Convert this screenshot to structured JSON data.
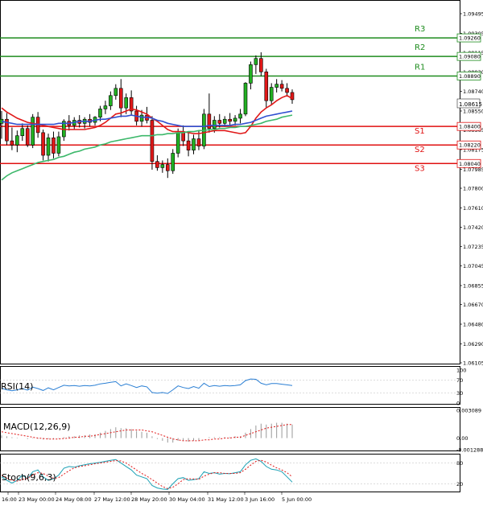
{
  "chart_data": {
    "type": "candlestick",
    "instrument_panel": {
      "price_ticks": [
        "1.09495",
        "1.09305",
        "1.09115",
        "1.08930",
        "1.08740",
        "1.08550",
        "1.08365",
        "1.08175",
        "1.07985",
        "1.07800",
        "1.07610",
        "1.07420",
        "1.07235",
        "1.07045",
        "1.06855",
        "1.06670",
        "1.06480",
        "1.06290",
        "1.06105"
      ],
      "ylim": [
        1.06105,
        1.09495
      ],
      "last_price": "1.08615",
      "levels": [
        {
          "name": "R3",
          "label": "1.09260",
          "value": 1.0926,
          "color": "#1e8c1e"
        },
        {
          "name": "R2",
          "label": "1.09080",
          "value": 1.0908,
          "color": "#1e8c1e"
        },
        {
          "name": "R1",
          "label": "1.08890",
          "value": 1.0889,
          "color": "#1e8c1e"
        },
        {
          "name": "S1",
          "label": "1.08400",
          "value": 1.084,
          "color": "#e01010"
        },
        {
          "name": "S2",
          "label": "1.08220",
          "value": 1.0822,
          "color": "#e01010"
        },
        {
          "name": "S3",
          "label": "1.08040",
          "value": 1.0804,
          "color": "#e01010"
        }
      ]
    },
    "x_ticks": [
      "16:00",
      "23 May 00:00",
      "24 May 08:00",
      "27 May 12:00",
      "28 May 20:00",
      "30 May 04:00",
      "31 May 12:00",
      "3 Jun 16:00",
      "5 Jun 00:00"
    ],
    "candles": [
      [
        1.0843,
        1.0855,
        1.0828,
        1.0847
      ],
      [
        1.0847,
        1.0853,
        1.0822,
        1.0826
      ],
      [
        1.0826,
        1.0839,
        1.0817,
        1.0822
      ],
      [
        1.0822,
        1.0836,
        1.0815,
        1.0831
      ],
      [
        1.0831,
        1.0843,
        1.0826,
        1.0838
      ],
      [
        1.0838,
        1.0841,
        1.082,
        1.0822
      ],
      [
        1.0822,
        1.0852,
        1.0819,
        1.0849
      ],
      [
        1.0849,
        1.0854,
        1.0829,
        1.0834
      ],
      [
        1.0834,
        1.0837,
        1.0807,
        1.0812
      ],
      [
        1.0812,
        1.0833,
        1.0806,
        1.0829
      ],
      [
        1.0829,
        1.0835,
        1.0809,
        1.0814
      ],
      [
        1.0814,
        1.0835,
        1.0811,
        1.083
      ],
      [
        1.083,
        1.0847,
        1.0826,
        1.0845
      ],
      [
        1.0845,
        1.0851,
        1.0836,
        1.0841
      ],
      [
        1.0841,
        1.0849,
        1.0837,
        1.0846
      ],
      [
        1.0846,
        1.0851,
        1.0839,
        1.0843
      ],
      [
        1.0843,
        1.0849,
        1.0838,
        1.0847
      ],
      [
        1.0847,
        1.0852,
        1.084,
        1.0844
      ],
      [
        1.0844,
        1.085,
        1.0841,
        1.0849
      ],
      [
        1.0849,
        1.086,
        1.0845,
        1.0857
      ],
      [
        1.0857,
        1.0865,
        1.0852,
        1.086
      ],
      [
        1.086,
        1.0874,
        1.0856,
        1.087
      ],
      [
        1.087,
        1.0881,
        1.0866,
        1.0877
      ],
      [
        1.0877,
        1.0886,
        1.0849,
        1.0858
      ],
      [
        1.0858,
        1.0872,
        1.0852,
        1.0868
      ],
      [
        1.0868,
        1.0875,
        1.0851,
        1.0855
      ],
      [
        1.0855,
        1.086,
        1.0841,
        1.0845
      ],
      [
        1.0845,
        1.0856,
        1.084,
        1.0851
      ],
      [
        1.0851,
        1.0859,
        1.0843,
        1.0846
      ],
      [
        1.0846,
        1.085,
        1.0798,
        1.0806
      ],
      [
        1.0806,
        1.0812,
        1.0797,
        1.08
      ],
      [
        1.08,
        1.0807,
        1.0795,
        1.0803
      ],
      [
        1.0803,
        1.0809,
        1.079,
        1.0797
      ],
      [
        1.0797,
        1.0818,
        1.0794,
        1.0814
      ],
      [
        1.0814,
        1.0838,
        1.081,
        1.0834
      ],
      [
        1.0834,
        1.0841,
        1.0821,
        1.0826
      ],
      [
        1.0826,
        1.0835,
        1.0811,
        1.0817
      ],
      [
        1.0817,
        1.0832,
        1.0813,
        1.0828
      ],
      [
        1.0828,
        1.0836,
        1.0817,
        1.0821
      ],
      [
        1.0821,
        1.0857,
        1.0818,
        1.0852
      ],
      [
        1.0852,
        1.0872,
        1.0834,
        1.0838
      ],
      [
        1.0838,
        1.085,
        1.0834,
        1.0846
      ],
      [
        1.0846,
        1.0852,
        1.0839,
        1.0843
      ],
      [
        1.0843,
        1.085,
        1.084,
        1.0847
      ],
      [
        1.0847,
        1.0853,
        1.0841,
        1.0845
      ],
      [
        1.0845,
        1.0851,
        1.0841,
        1.0848
      ],
      [
        1.0848,
        1.0857,
        1.0843,
        1.0852
      ],
      [
        1.0852,
        1.0883,
        1.085,
        1.0882
      ],
      [
        1.0882,
        1.0903,
        1.0876,
        1.09
      ],
      [
        1.09,
        1.0909,
        1.0891,
        1.0906
      ],
      [
        1.0906,
        1.0912,
        1.0889,
        1.0893
      ],
      [
        1.0893,
        1.0896,
        1.0858,
        1.0865
      ],
      [
        1.0865,
        1.0882,
        1.0861,
        1.0878
      ],
      [
        1.0878,
        1.0886,
        1.0873,
        1.0881
      ],
      [
        1.0881,
        1.0885,
        1.0874,
        1.0877
      ],
      [
        1.0877,
        1.0882,
        1.0869,
        1.0873
      ],
      [
        1.0873,
        1.0876,
        1.0862,
        1.0866
      ]
    ],
    "ma_series": [
      {
        "color": "#e01818",
        "values": [
          1.0858,
          1.0854,
          1.0851,
          1.0848,
          1.0846,
          1.0844,
          1.0843,
          1.0842,
          1.0841,
          1.084,
          1.0839,
          1.0838,
          1.0837,
          1.0837,
          1.0837,
          1.0837,
          1.0837,
          1.0838,
          1.0839,
          1.0841,
          1.0844,
          1.0848,
          1.0852,
          1.0853,
          1.0855,
          1.0857,
          1.0856,
          1.0854,
          1.0852,
          1.0848,
          1.0845,
          1.0841,
          1.0837,
          1.0835,
          1.0835,
          1.0835,
          1.0834,
          1.0833,
          1.0833,
          1.0834,
          1.0835,
          1.0836,
          1.0836,
          1.0836,
          1.0835,
          1.0834,
          1.0833,
          1.0834,
          1.084,
          1.0848,
          1.0854,
          1.0858,
          1.0861,
          1.0865,
          1.0868,
          1.087,
          1.0867
        ]
      },
      {
        "color": "#3050d0",
        "values": [
          1.0845,
          1.0844,
          1.0843,
          1.0842,
          1.0842,
          1.0842,
          1.0842,
          1.0842,
          1.0842,
          1.0842,
          1.0842,
          1.0843,
          1.0843,
          1.0843,
          1.0844,
          1.0845,
          1.0845,
          1.0845,
          1.0846,
          1.0847,
          1.0847,
          1.0848,
          1.0849,
          1.085,
          1.085,
          1.0851,
          1.085,
          1.0849,
          1.0849,
          1.0848,
          1.0846,
          1.0845,
          1.0843,
          1.0842,
          1.0841,
          1.084,
          1.084,
          1.084,
          1.084,
          1.084,
          1.0841,
          1.0841,
          1.0841,
          1.0841,
          1.0841,
          1.0842,
          1.0842,
          1.0843,
          1.0844,
          1.0846,
          1.0848,
          1.085,
          1.0851,
          1.0852,
          1.0853,
          1.0854,
          1.0855
        ]
      },
      {
        "color": "#3cb86a",
        "values": [
          1.0788,
          1.0792,
          1.0795,
          1.0797,
          1.0799,
          1.0801,
          1.0803,
          1.0805,
          1.0806,
          1.0807,
          1.0808,
          1.081,
          1.0811,
          1.0813,
          1.0815,
          1.0816,
          1.0818,
          1.0819,
          1.082,
          1.0822,
          1.0823,
          1.0825,
          1.0826,
          1.0827,
          1.0828,
          1.0829,
          1.083,
          1.0831,
          1.0831,
          1.0831,
          1.0832,
          1.0832,
          1.0833,
          1.0833,
          1.0834,
          1.0834,
          1.0835,
          1.0835,
          1.0836,
          1.0836,
          1.0837,
          1.0837,
          1.0838,
          1.0838,
          1.0839,
          1.0839,
          1.084,
          1.084,
          1.0841,
          1.0842,
          1.0843,
          1.0845,
          1.0846,
          1.0847,
          1.0849,
          1.085,
          1.0851
        ]
      }
    ],
    "rsi": {
      "label": "RSI(14)",
      "ticks": [
        "100",
        "70",
        "30",
        "0"
      ],
      "ylim": [
        0,
        100
      ],
      "values": [
        45,
        40,
        37,
        40,
        44,
        39,
        48,
        44,
        38,
        46,
        40,
        47,
        54,
        52,
        53,
        51,
        53,
        52,
        54,
        58,
        60,
        63,
        65,
        52,
        58,
        53,
        47,
        52,
        49,
        32,
        30,
        32,
        29,
        40,
        52,
        47,
        44,
        50,
        45,
        60,
        50,
        53,
        51,
        53,
        52,
        53,
        55,
        68,
        73,
        72,
        60,
        55,
        59,
        59,
        57,
        55,
        53
      ]
    },
    "macd": {
      "label": "MACD(12,26,9)",
      "ticks": [
        "0.003089",
        "0.00",
        "-0.001288"
      ],
      "ylim": [
        -0.001288,
        0.003089
      ],
      "histogram": [
        0.0003,
        0.0002,
        0.0001,
        5e-05,
        0.0,
        -0.0001,
        -5e-05,
        -8e-05,
        -0.00015,
        -0.0001,
        -0.00012,
        -5e-05,
        0.0001,
        0.0002,
        0.0002,
        0.0003,
        0.0003,
        0.0004,
        0.0004,
        0.0006,
        0.0008,
        0.001,
        0.0012,
        0.0011,
        0.0011,
        0.001,
        0.0008,
        0.0007,
        0.0006,
        0.0002,
        -0.0001,
        -0.0003,
        -0.0005,
        -0.0005,
        -0.0003,
        -0.0003,
        -0.0004,
        -0.0003,
        -0.0003,
        0.0,
        0.0001,
        0.0001,
        0.0001,
        0.0001,
        0.0001,
        0.0002,
        0.0002,
        0.0006,
        0.001,
        0.0014,
        0.0016,
        0.0015,
        0.0016,
        0.0017,
        0.0017,
        0.0016,
        0.0015
      ],
      "signal": [
        0.0007,
        0.0006,
        0.0005,
        0.0004,
        0.0003,
        0.0002,
        0.0001,
        0.0,
        -5e-05,
        -0.0001,
        -0.0001,
        -0.0001,
        -5e-05,
        0.0,
        0.0001,
        0.0001,
        0.0002,
        0.0002,
        0.0003,
        0.0004,
        0.0005,
        0.0006,
        0.0007,
        0.0008,
        0.0009,
        0.0009,
        0.0009,
        0.0009,
        0.0008,
        0.0007,
        0.0005,
        0.0003,
        0.0001,
        -0.0001,
        -0.0002,
        -0.0003,
        -0.0003,
        -0.0003,
        -0.0003,
        -0.0002,
        -0.0002,
        -0.0001,
        -0.0001,
        0.0,
        0.0,
        0.0001,
        0.0001,
        0.0003,
        0.0005,
        0.0007,
        0.0009,
        0.0011,
        0.0012,
        0.0013,
        0.0014,
        0.0015,
        0.0015
      ]
    },
    "stoch": {
      "label": "Stoch(9,6,3)",
      "ticks": [
        "80",
        "20"
      ],
      "ylim": [
        0,
        100
      ],
      "k": [
        40,
        30,
        22,
        30,
        45,
        35,
        55,
        60,
        40,
        30,
        35,
        45,
        65,
        70,
        68,
        72,
        75,
        78,
        80,
        82,
        85,
        88,
        90,
        80,
        70,
        60,
        45,
        40,
        35,
        15,
        8,
        5,
        4,
        20,
        35,
        38,
        30,
        32,
        35,
        55,
        50,
        52,
        48,
        50,
        49,
        52,
        55,
        75,
        88,
        92,
        85,
        70,
        62,
        60,
        55,
        40,
        25
      ],
      "d": [
        45,
        38,
        30,
        28,
        32,
        36,
        45,
        52,
        50,
        42,
        36,
        38,
        48,
        58,
        66,
        70,
        72,
        75,
        78,
        80,
        82,
        85,
        87,
        86,
        80,
        70,
        60,
        50,
        42,
        32,
        22,
        12,
        6,
        10,
        20,
        32,
        35,
        34,
        33,
        42,
        48,
        52,
        52,
        50,
        50,
        50,
        52,
        62,
        74,
        85,
        88,
        83,
        74,
        66,
        60,
        52,
        40
      ]
    }
  }
}
